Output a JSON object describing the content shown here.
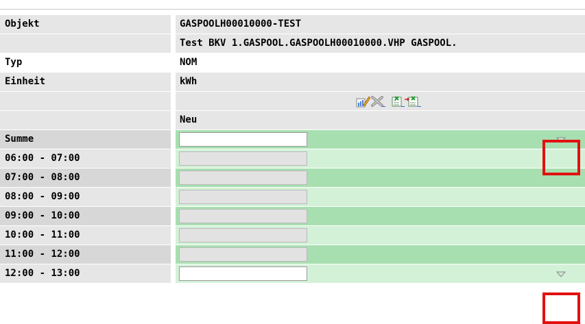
{
  "rows_header": [
    {
      "label": "Objekt",
      "value": "GASPOOLH00010000-TEST"
    },
    {
      "label": "",
      "value": "Test BKV 1.GASPOOL.GASPOOLH00010000.VHP GASPOOL."
    },
    {
      "label": "Typ",
      "value": "NOM"
    },
    {
      "label": "Einheit",
      "value": "kWh"
    },
    {
      "label": "",
      "value": ""
    },
    {
      "label": "",
      "value": "Neu"
    }
  ],
  "summe": {
    "label": "Summe"
  },
  "hours": [
    {
      "label": "06:00 - 07:00"
    },
    {
      "label": "07:00 - 08:00"
    },
    {
      "label": "08:00 - 09:00"
    },
    {
      "label": "09:00 - 10:00"
    },
    {
      "label": "10:00 - 11:00"
    },
    {
      "label": "11:00 - 12:00"
    },
    {
      "label": "12:00 - 13:00"
    }
  ],
  "icons": [
    "edit-icon",
    "delete-icon",
    "export-icon",
    "import-icon"
  ],
  "colors": {
    "green_dark": "#a8dfb0",
    "green_light": "#d3f1d7",
    "highlight": "#e21010"
  }
}
